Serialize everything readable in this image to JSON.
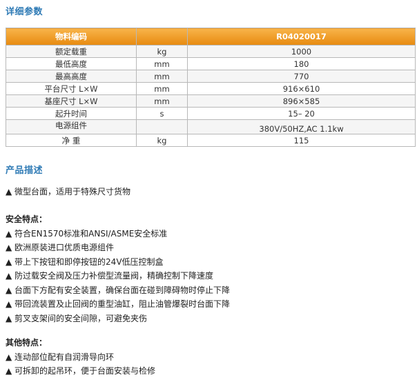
{
  "sections": {
    "params_title": "详细参数",
    "desc_title": "产品描述"
  },
  "table": {
    "header": [
      "物料编码",
      "",
      "R04020017"
    ],
    "rows": [
      [
        "额定载重",
        "kg",
        "1000"
      ],
      [
        "最低高度",
        "mm",
        "180"
      ],
      [
        "最高高度",
        "mm",
        "770"
      ],
      [
        "平台尺寸 L×W",
        "mm",
        "916×610"
      ],
      [
        "基座尺寸 L×W",
        "mm",
        "896×585"
      ],
      [
        "起升时间",
        "s",
        "15– 20"
      ],
      [
        "电源组件",
        "",
        "380V/50HZ,AC 1.1kw"
      ],
      [
        "净 重",
        "kg",
        "115"
      ]
    ]
  },
  "description": {
    "intro": "▲ 微型台面，适用于特殊尺寸货物",
    "safety_heading": "安全特点：",
    "safety_items": [
      "▲ 符合EN1570标准和ANSI/ASME安全标准",
      "▲ 欧洲原装进口优质电源组件",
      "▲ 带上下按钮和即停按钮的24V低压控制盒",
      "▲ 防过载安全阀及压力补偿型流量阀，精确控制下降速度",
      "▲ 台面下方配有安全装置，确保台面在碰到障碍物时停止下降",
      "▲ 带回流装置及止回阀的重型油缸，阻止油管爆裂时台面下降",
      "▲ 剪叉支架间的安全间隙，可避免夹伤"
    ],
    "other_heading": "其他特点：",
    "other_items": [
      "▲ 连动部位配有自润滑导向环",
      "▲ 可拆卸的起吊环，便于台面安装与检修"
    ]
  },
  "colors": {
    "title": "#2e7ab5",
    "table_header": "#f0a030",
    "border": "#b8b8b8"
  }
}
